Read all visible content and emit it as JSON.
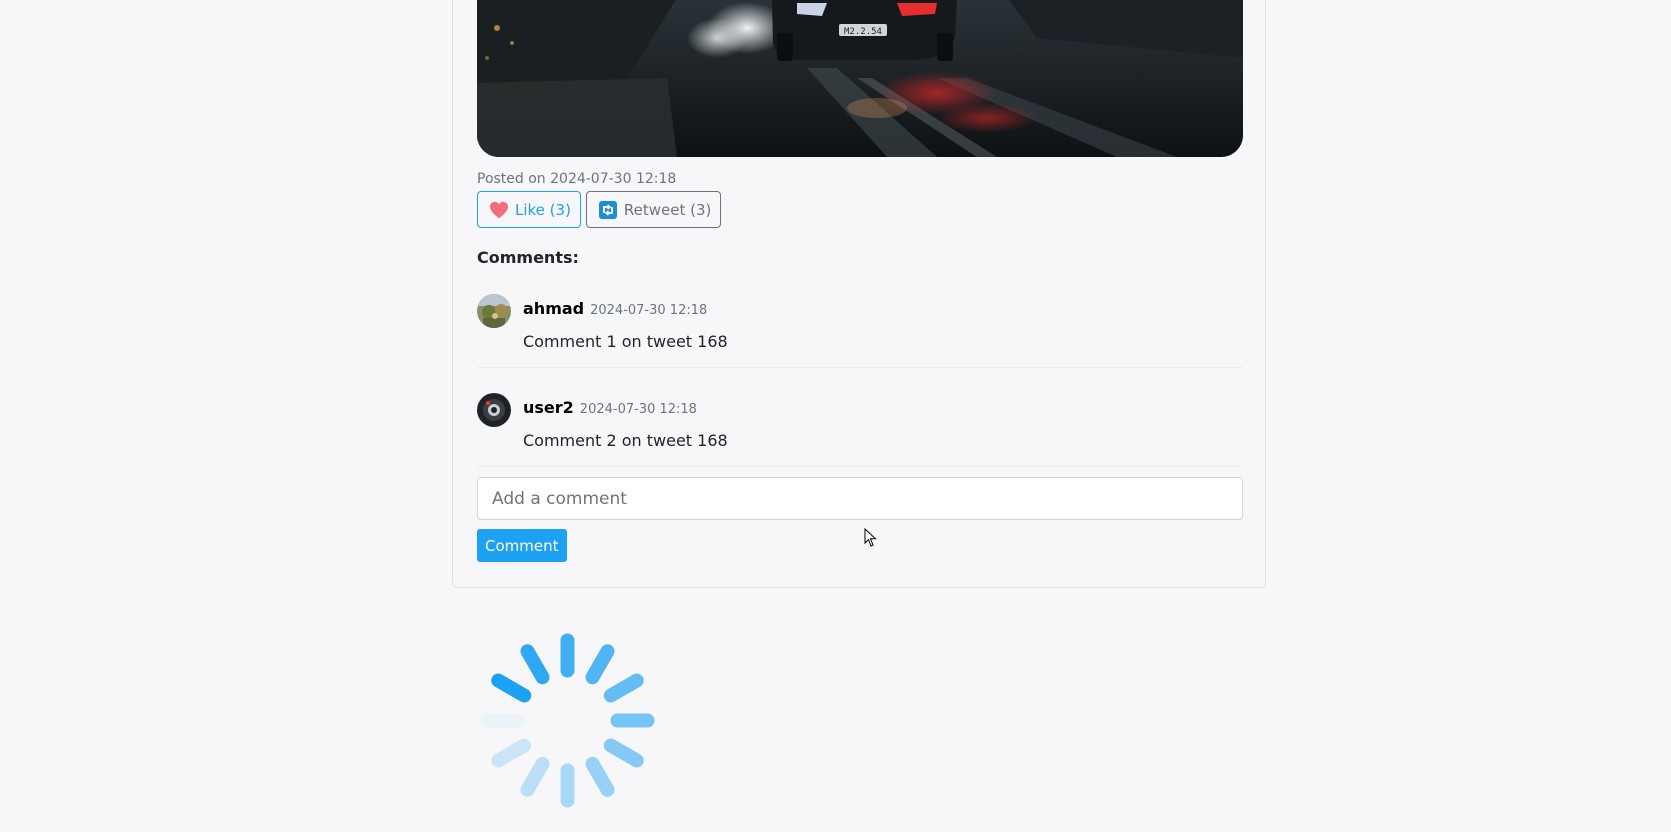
{
  "tweet": {
    "image_alt": "Car drifting on wet road",
    "plate_text": "M2.2.54",
    "posted_label": "Posted on 2024-07-30 12:18",
    "like_label": "Like (3)",
    "retweet_label": "Retweet (3)",
    "like_icon": "heart-icon",
    "retweet_icon": "retweet-icon"
  },
  "comments": {
    "heading": "Comments:",
    "items": [
      {
        "username": "ahmad",
        "time": "2024-07-30 12:18",
        "text": "Comment 1 on tweet 168"
      },
      {
        "username": "user2",
        "time": "2024-07-30 12:18",
        "text": "Comment 2 on tweet 168"
      }
    ],
    "input_placeholder": "Add a comment",
    "submit_label": "Comment"
  },
  "colors": {
    "accent": "#1da1f2",
    "heart": "#f26d7d",
    "spinner": "#1da1f2"
  },
  "loading_icon": "spinner-icon"
}
